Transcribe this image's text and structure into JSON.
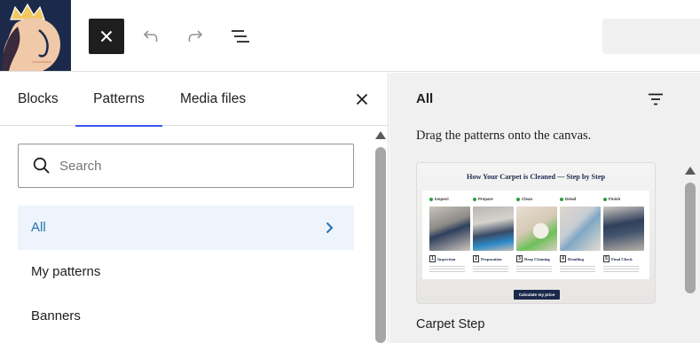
{
  "colors": {
    "accent": "#3858e9",
    "active_category_text": "#2271b1",
    "active_category_bg": "#eef4fb",
    "logo_background": "#1b2a4a"
  },
  "toolbar": {
    "logo_icon": "site-logo-crown-woman",
    "close_icon": "close-icon",
    "undo_icon": "undo-icon",
    "redo_icon": "redo-icon",
    "outline_icon": "document-outline-icon"
  },
  "inserter": {
    "tabs": [
      {
        "label": "Blocks"
      },
      {
        "label": "Patterns",
        "active": true
      },
      {
        "label": "Media files"
      }
    ],
    "close_icon": "close-icon",
    "search": {
      "placeholder": "Search",
      "value": "",
      "icon": "search-icon"
    },
    "categories": [
      {
        "label": "All",
        "active": true,
        "icon": "chevron-right-icon"
      },
      {
        "label": "My patterns"
      },
      {
        "label": "Banners"
      }
    ]
  },
  "patterns": {
    "title": "All",
    "filter_icon": "filter-icon",
    "hint": "Drag the patterns onto the canvas.",
    "items": [
      {
        "label": "Carpet Step",
        "preview": {
          "heading": "How Your Carpet is Cleaned — Step by Step",
          "steps": [
            {
              "tag": "Inspect",
              "number": "1",
              "name": "Inspection"
            },
            {
              "tag": "Prepare",
              "number": "2",
              "name": "Preparation"
            },
            {
              "tag": "Clean",
              "number": "3",
              "name": "Deep Cleaning"
            },
            {
              "tag": "Detail",
              "number": "4",
              "name": "Detailing"
            },
            {
              "tag": "Finish",
              "number": "5",
              "name": "Final Check"
            }
          ],
          "cta": "Calculate my price"
        }
      }
    ]
  }
}
